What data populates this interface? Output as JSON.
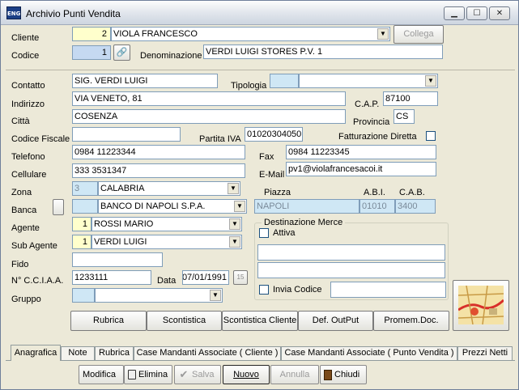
{
  "window": {
    "title": "Archivio Punti Vendita",
    "icon_text": "ENG"
  },
  "controls": {
    "minimize": "▁",
    "maximize": "☐",
    "close": "✕"
  },
  "form": {
    "cliente_label": "Cliente",
    "cliente_code": "2",
    "cliente_name": "VIOLA FRANCESCO",
    "collega": "Collega",
    "codice_label": "Codice",
    "codice_value": "1",
    "denominazione_label": "Denominazione",
    "denominazione_value": "VERDI LUIGI STORES P.V. 1",
    "contatto_label": "Contatto",
    "contatto_value": "SIG. VERDI LUIGI",
    "tipologia_label": "Tipologia",
    "tipologia_value": "",
    "indirizzo_label": "Indirizzo",
    "indirizzo_value": "VIA VENETO, 81",
    "cap_label": "C.A.P.",
    "cap_value": "87100",
    "citta_label": "Città",
    "citta_value": "COSENZA",
    "provincia_label": "Provincia",
    "provincia_value": "CS",
    "cf_label": "Codice Fiscale",
    "cf_value": "",
    "piva_label": "Partita IVA",
    "piva_value": "01020304050",
    "fatt_label": "Fatturazione Diretta",
    "telefono_label": "Telefono",
    "telefono_value": "0984 11223344",
    "fax_label": "Fax",
    "fax_value": "0984 11223345",
    "cellulare_label": "Cellulare",
    "cellulare_value": "333 3531347",
    "email_label": "E-Mail",
    "email_value": "pv1@violafrancesacoi.it",
    "zona_label": "Zona",
    "zona_code": "3",
    "zona_value": "CALABRIA",
    "banca_label": "Banca",
    "banca_value": "BANCO DI NAPOLI S.P.A.",
    "piazza_label": "Piazza",
    "piazza_value": "NAPOLI",
    "abi_label": "A.B.I.",
    "abi_value": "01010",
    "cab_label": "C.A.B.",
    "cab_value": "3400",
    "agente_label": "Agente",
    "agente_code": "1",
    "agente_value": "ROSSI MARIO",
    "subagente_label": "Sub Agente",
    "subagente_code": "1",
    "subagente_value": "VERDI LUIGI",
    "fido_label": "Fido",
    "fido_value": "",
    "cciaa_label": "N° C.C.I.A.A.",
    "cciaa_value": "1233111",
    "data_label": "Data",
    "data_value": "07/01/1991",
    "cal_btn": "15",
    "gruppo_label": "Gruppo",
    "gruppo_value": "",
    "dest_title": "Destinazione Merce",
    "attiva_label": "Attiva",
    "invia_label": "Invia Codice"
  },
  "actions": [
    "Rubrica",
    "Scontistica",
    "Scontistica Cliente",
    "Def. OutPut",
    "Promem.Doc."
  ],
  "tabs": [
    "Anagrafica",
    "Note",
    "Rubrica",
    "Case Mandanti Associate ( Cliente )",
    "Case Mandanti Associate ( Punto Vendita )",
    "Prezzi Netti"
  ],
  "bottom": {
    "modifica": "Modifica",
    "elimina": "Elimina",
    "salva": "Salva",
    "nuovo": "Nuovo",
    "annulla": "Annulla",
    "chiudi": "Chiudi"
  }
}
